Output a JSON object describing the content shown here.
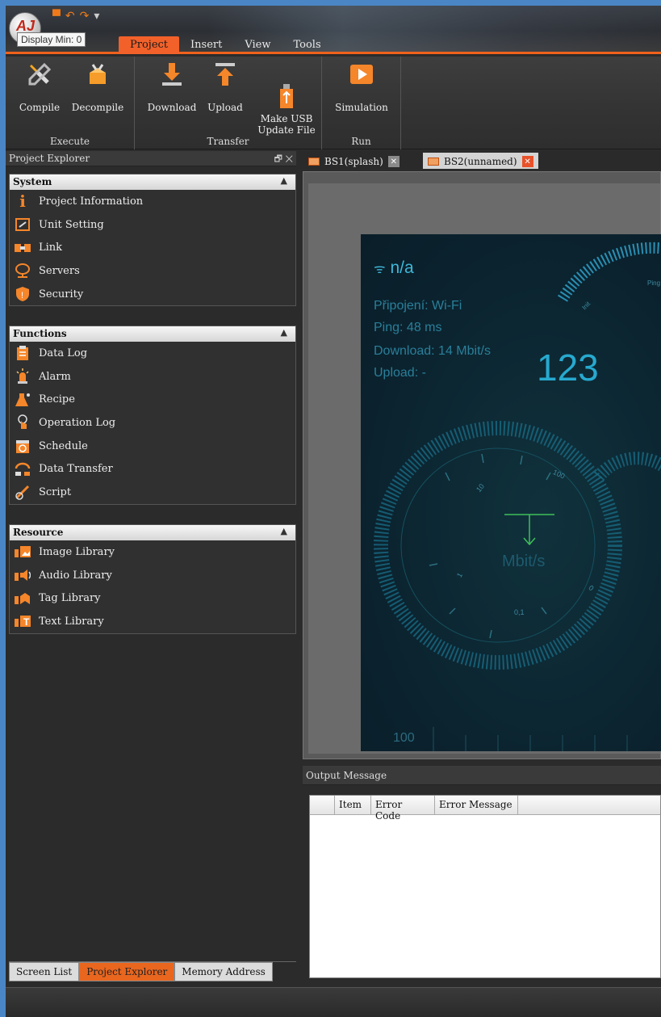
{
  "tooltip": "Display Min: 0",
  "app_logo_text": "AJ",
  "qat": {
    "save": "▀",
    "undo": "↶",
    "redo": "↷",
    "more": "▾"
  },
  "ribbon_tabs": [
    "Project",
    "Insert",
    "View",
    "Tools"
  ],
  "ribbon": {
    "groups": [
      {
        "label": "Execute",
        "buttons": [
          "Compile",
          "Decompile"
        ]
      },
      {
        "label": "Transfer",
        "buttons": [
          "Download",
          "Upload",
          "Make USB\nUpdate File"
        ]
      },
      {
        "label": "Run",
        "buttons": [
          "Simulation"
        ]
      }
    ]
  },
  "explorer": {
    "title": "Project Explorer",
    "win_controls": "🗗 ✕",
    "sections": [
      {
        "title": "System",
        "items": [
          "Project Information",
          "Unit Setting",
          "Link",
          "Servers",
          "Security"
        ]
      },
      {
        "title": "Functions",
        "items": [
          "Data Log",
          "Alarm",
          "Recipe",
          "Operation Log",
          "Schedule",
          "Data Transfer",
          "Script"
        ]
      },
      {
        "title": "Resource",
        "items": [
          "Image Library",
          "Audio Library",
          "Tag Library",
          "Text Library"
        ]
      }
    ],
    "bottom_tabs": [
      "Screen List",
      "Project Explorer",
      "Memory Address"
    ]
  },
  "doc_tabs": [
    "BS1(splash)",
    "BS2(unnamed)"
  ],
  "screen": {
    "ssid": "n/a",
    "connection": "Připojení: Wi-Fi",
    "ping": "Ping: 48 ms",
    "download": "Download: 14 Mbit/s",
    "upload": "Upload: -",
    "big_value": "123",
    "unit": "Mbit/s",
    "scale_100": "100",
    "gauge_labels": [
      "10",
      "100",
      "1",
      "0",
      "0,1"
    ],
    "arc_labels": [
      "Ping",
      "Init"
    ]
  },
  "output": {
    "title": "Output Message",
    "columns": [
      "",
      "Item",
      "Error Code",
      "Error Message"
    ]
  },
  "colors": {
    "accent": "#f2612a",
    "screen_bg": "#0b2430",
    "screen_text": "#2a7f9a",
    "screen_bright": "#3fb7d8",
    "arrow_green": "#3fbf5a"
  }
}
